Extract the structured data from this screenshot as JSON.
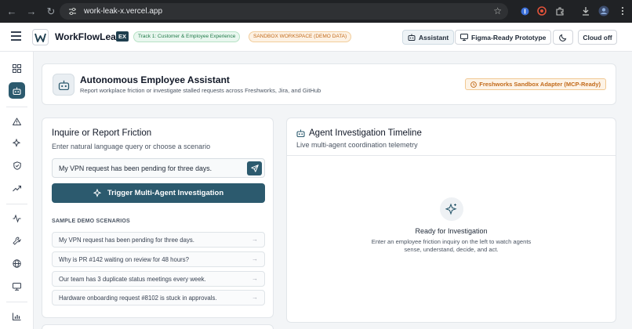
{
  "browser": {
    "url": "work-leak-x.vercel.app",
    "icons": [
      "back-icon",
      "forward-icon",
      "reload-icon",
      "site-info-icon",
      "bookmark-star-icon",
      "extension-icon",
      "downloads-icon",
      "profile-icon"
    ]
  },
  "header": {
    "app_name": "WorkFlowLeak",
    "app_badge": "EX",
    "track_pill": "Track 1: Customer & Employee Experience",
    "sandbox_pill": "SANDBOX WORKSPACE (DEMO DATA)",
    "assistant_button": "Assistant",
    "figma_button": "Figma-Ready Prototype",
    "cloud_button": "Cloud off"
  },
  "sidebar": {
    "icons": [
      "dashboard-icon",
      "assistant-bot-icon",
      "alert-icon",
      "sparkle-icon",
      "shield-icon",
      "trend-icon",
      "pulse-icon",
      "tools-icon",
      "globe-icon",
      "monitor-icon",
      "bar-chart-icon"
    ],
    "active": "assistant-bot-icon"
  },
  "hero": {
    "title": "Autonomous Employee Assistant",
    "subtitle": "Report workplace friction or investigate stalled requests across Freshworks, Jira, and GitHub",
    "adapter_badge": "Freshworks Sandbox Adapter (MCP-Ready)"
  },
  "inquire": {
    "title": "Inquire or Report Friction",
    "subtitle": "Enter natural language query or choose a scenario",
    "query_value": "My VPN request has been pending for three days.",
    "trigger_label": "Trigger Multi-Agent Investigation",
    "scenarios_heading": "SAMPLE DEMO SCENARIOS",
    "scenarios": [
      "My VPN request has been pending for three days.",
      "Why is PR #142 waiting on review for 48 hours?",
      "Our team has 3 duplicate status meetings every week.",
      "Hardware onboarding request #8102 is stuck in approvals."
    ]
  },
  "timeline": {
    "title": "Agent Investigation Timeline",
    "subtitle": "Live multi-agent coordination telemetry",
    "ready_title": "Ready for Investigation",
    "ready_line1": "Enter an employee friction inquiry on the left to watch agents",
    "ready_line2": "sense, understand, decide, and act."
  },
  "colors": {
    "accent": "#2c5a6e",
    "success": "#1f7a48",
    "warning": "#c26a1a"
  }
}
